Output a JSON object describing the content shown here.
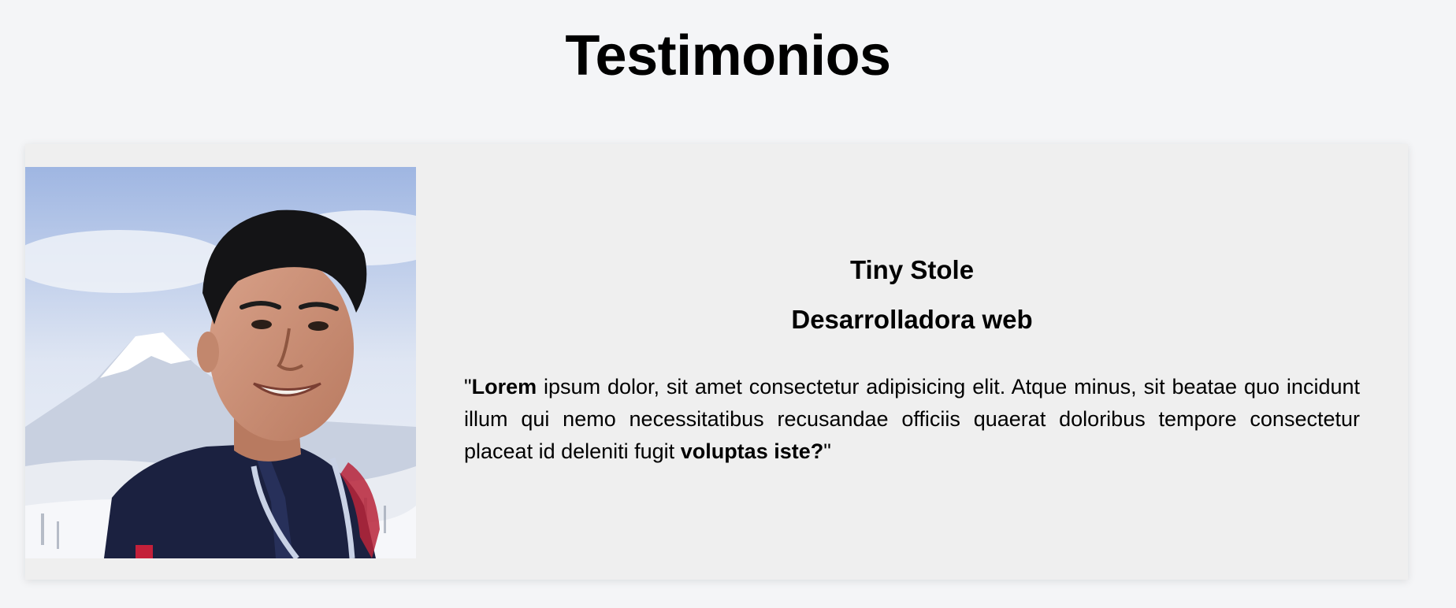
{
  "page": {
    "title": "Testimonios"
  },
  "testimonial": {
    "photo_icon": "person-photo",
    "name": "Tiny Stole",
    "role": "Desarrolladora web",
    "quote": {
      "open_mark": "\"",
      "lead_bold": "Lorem",
      "body": " ipsum dolor, sit amet consectetur adipisicing elit. Atque minus, sit beatae quo incidunt illum qui nemo necessitatibus recusandae officiis quaerat doloribus tempore consectetur placeat id deleniti fugit ",
      "tail_bold": "voluptas iste?",
      "close_mark": "\""
    }
  },
  "colors": {
    "page_background": "#f4f5f7",
    "card_background": "#efefef",
    "text": "#000000"
  }
}
